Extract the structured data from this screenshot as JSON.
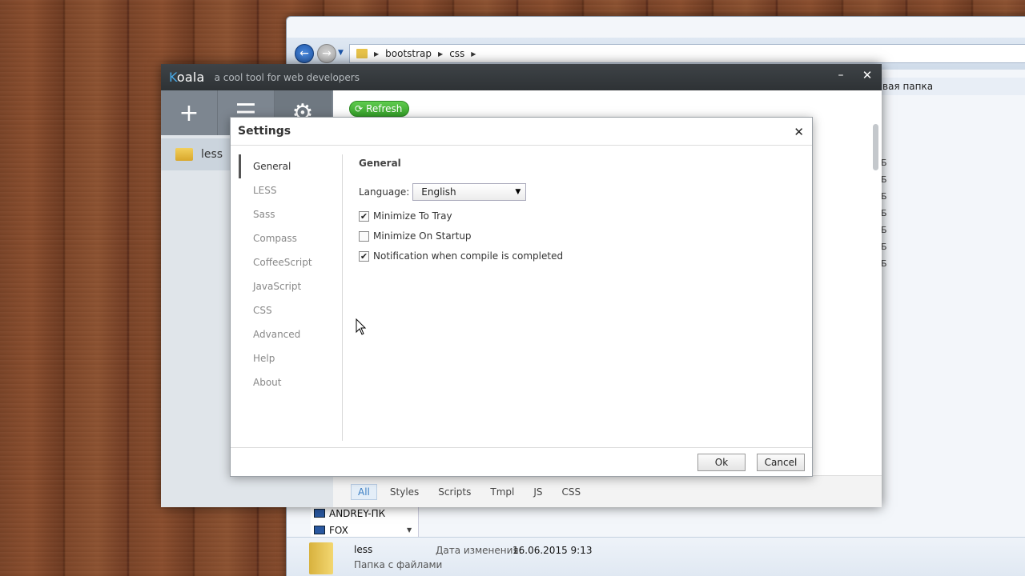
{
  "explorer": {
    "breadcrumbs": [
      "bootstrap",
      "css"
    ],
    "new_folder_text": "вая папка",
    "right_column_items": [
      "Б",
      "Б",
      "Б",
      "Б",
      "Б",
      "Б",
      "Б"
    ],
    "nav_items": [
      "ANDREY-ПК",
      "FOX"
    ],
    "details": {
      "name": "less",
      "type": "Папка с файлами",
      "modified_label": "Дата изменения:",
      "modified_value": "16.06.2015 9:13"
    }
  },
  "koala": {
    "logo_first": "K",
    "logo_rest": "oala",
    "tagline": "a cool tool for web developers",
    "minimize_glyph": "–",
    "close_glyph": "✕",
    "tools": {
      "add": "+",
      "list": "☰",
      "settings": "⚙"
    },
    "project": "less",
    "refresh_label": "Refresh",
    "filters": [
      "All",
      "Styles",
      "Scripts",
      "Tmpl",
      "JS",
      "CSS"
    ],
    "active_filter": "All"
  },
  "settings": {
    "title": "Settings",
    "close_glyph": "✕",
    "nav": [
      "General",
      "LESS",
      "Sass",
      "Compass",
      "CoffeeScript",
      "JavaScript",
      "CSS",
      "Advanced",
      "Help",
      "About"
    ],
    "active_nav": "General",
    "section_title": "General",
    "language_label": "Language:",
    "language_value": "English",
    "options": [
      {
        "label": "Minimize To Tray",
        "checked": true
      },
      {
        "label": "Minimize On Startup",
        "checked": false
      },
      {
        "label": "Notification when compile is completed",
        "checked": true
      }
    ],
    "ok_label": "Ok",
    "cancel_label": "Cancel"
  }
}
